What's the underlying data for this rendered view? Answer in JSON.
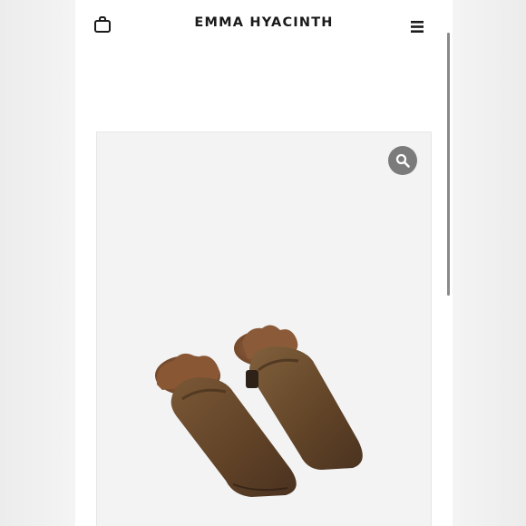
{
  "header": {
    "brand": "EMMA HYACINTH",
    "bag_icon": "shopping-bag-icon",
    "menu_icon": "hamburger-menu-icon"
  },
  "product": {
    "zoom_icon": "magnifier-icon",
    "image": "brown-leather-mules-with-fur-trim"
  },
  "colors": {
    "zoom_button": "#7b7b7b",
    "leather": "#6b4a2e",
    "fur": "#8a5a3a",
    "image_background": "#f3f3f4"
  }
}
